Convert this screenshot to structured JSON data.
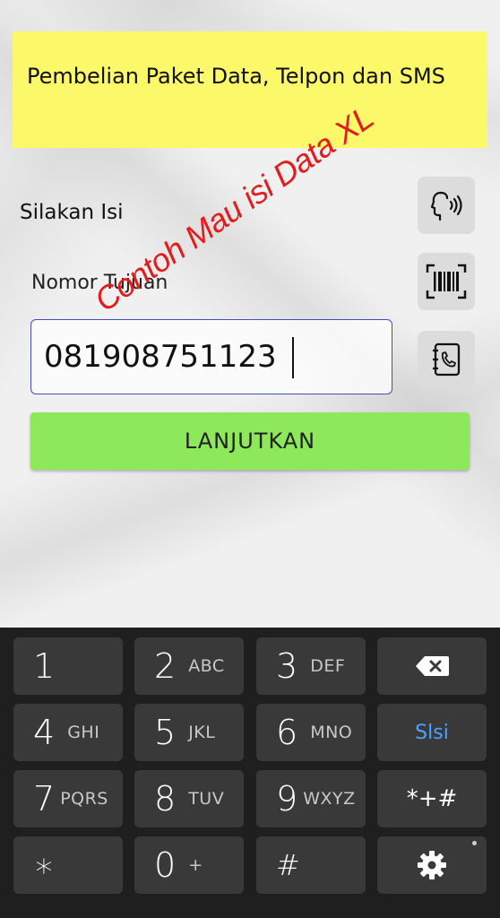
{
  "header": {
    "title": "Pembelian Paket Data, Telpon dan SMS"
  },
  "form": {
    "section_label": "Silakan Isi",
    "field_label": "Nomor Tujuan",
    "phone_value": "081908751123",
    "submit_label": "LANJUTKAN"
  },
  "side_buttons": [
    {
      "icon": "voice-input-icon"
    },
    {
      "icon": "barcode-scan-icon"
    },
    {
      "icon": "contact-book-icon"
    }
  ],
  "watermark": "Contoh Mau isi Data XL",
  "colors": {
    "banner": "#fbf86a",
    "button": "#8ee95a",
    "watermark": "#e51b1b",
    "input_border": "#3f51b5",
    "keyboard_bg": "#1f1f1f",
    "key_bg": "#393939",
    "slsi_accent": "#4aa3ff"
  },
  "keyboard": {
    "k1": {
      "num": "1",
      "letters": ""
    },
    "k2": {
      "num": "2",
      "letters": "ABC"
    },
    "k3": {
      "num": "3",
      "letters": "DEF"
    },
    "k4": {
      "num": "4",
      "letters": "GHI"
    },
    "k5": {
      "num": "5",
      "letters": "JKL"
    },
    "k6": {
      "num": "6",
      "letters": "MNO"
    },
    "k7": {
      "num": "7",
      "letters": "PQRS"
    },
    "k8": {
      "num": "8",
      "letters": "TUV"
    },
    "k9": {
      "num": "9",
      "letters": "WXYZ"
    },
    "k0": {
      "num": "0",
      "letters": "+"
    },
    "star": "∗",
    "hash": "#",
    "slsi": "Slsi",
    "symbols": "*+#"
  }
}
